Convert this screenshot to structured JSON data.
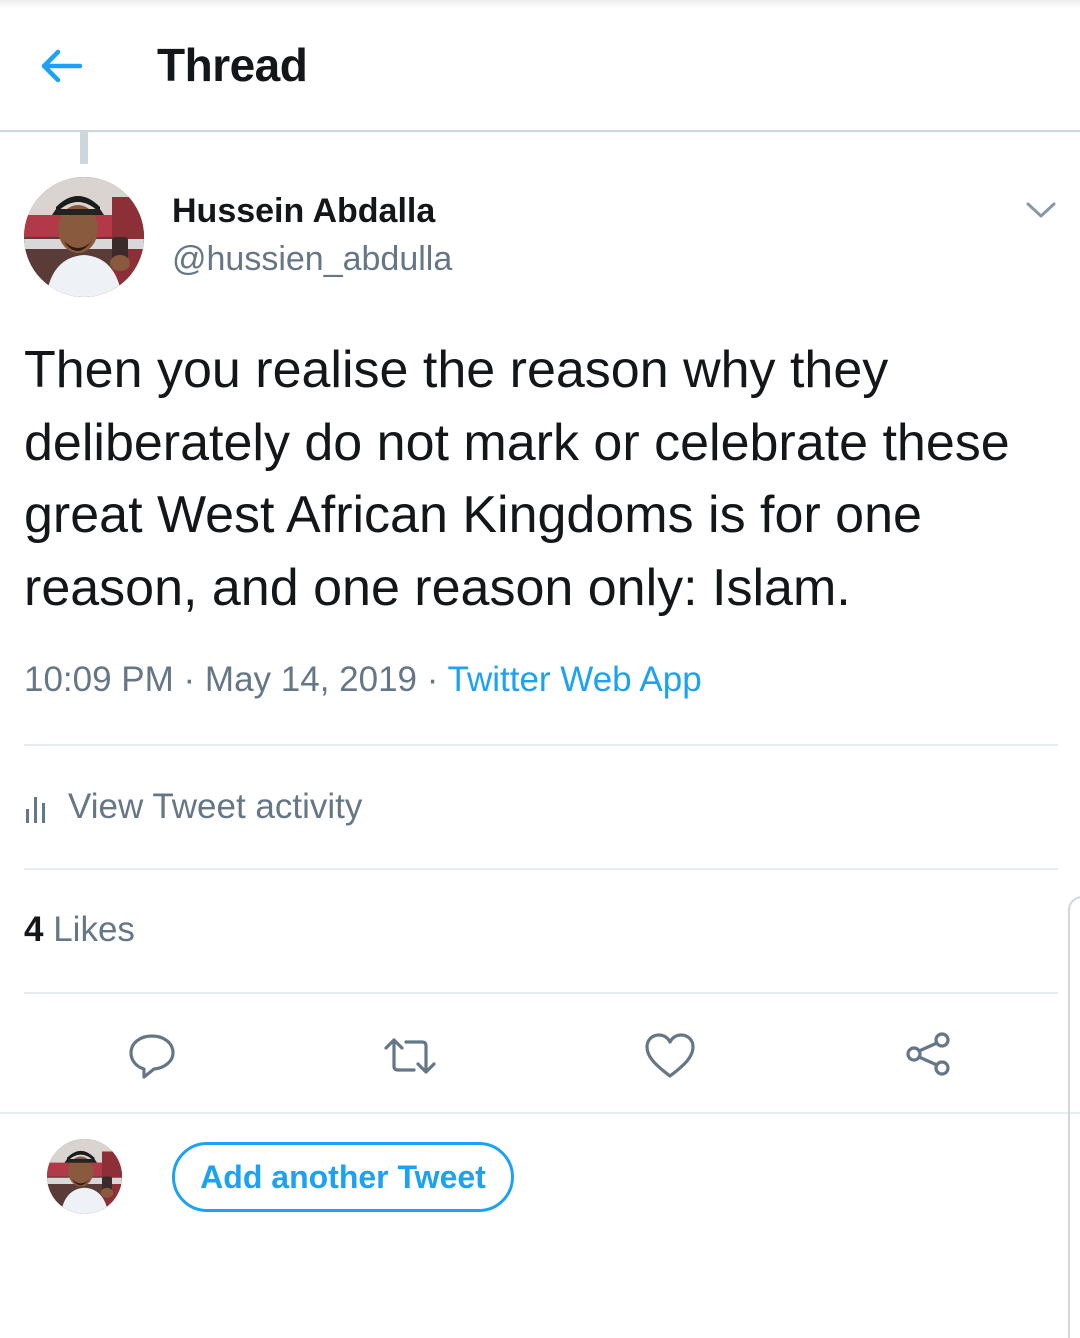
{
  "header": {
    "title": "Thread",
    "back_icon": "arrow-left-icon"
  },
  "tweet": {
    "author_name": "Hussein Abdalla",
    "author_handle": "@hussien_abdulla",
    "text": "Then you realise the reason why they deliberately do not mark or celebrate these great West African Kingdoms is for one reason, and one reason only: Islam.",
    "time": "10:09 PM",
    "separator": " · ",
    "date": "May 14, 2019",
    "source": "Twitter Web App",
    "activity_label": "View Tweet activity",
    "likes_count": "4",
    "likes_label": "Likes"
  },
  "actions": {
    "reply_icon": "reply-icon",
    "retweet_icon": "retweet-icon",
    "like_icon": "heart-icon",
    "share_icon": "share-icon"
  },
  "composer": {
    "add_button_label": "Add another Tweet"
  },
  "colors": {
    "accent": "#1da1f2",
    "text_primary": "#14171a",
    "text_secondary": "#657786",
    "divider": "#e6ecf0"
  }
}
